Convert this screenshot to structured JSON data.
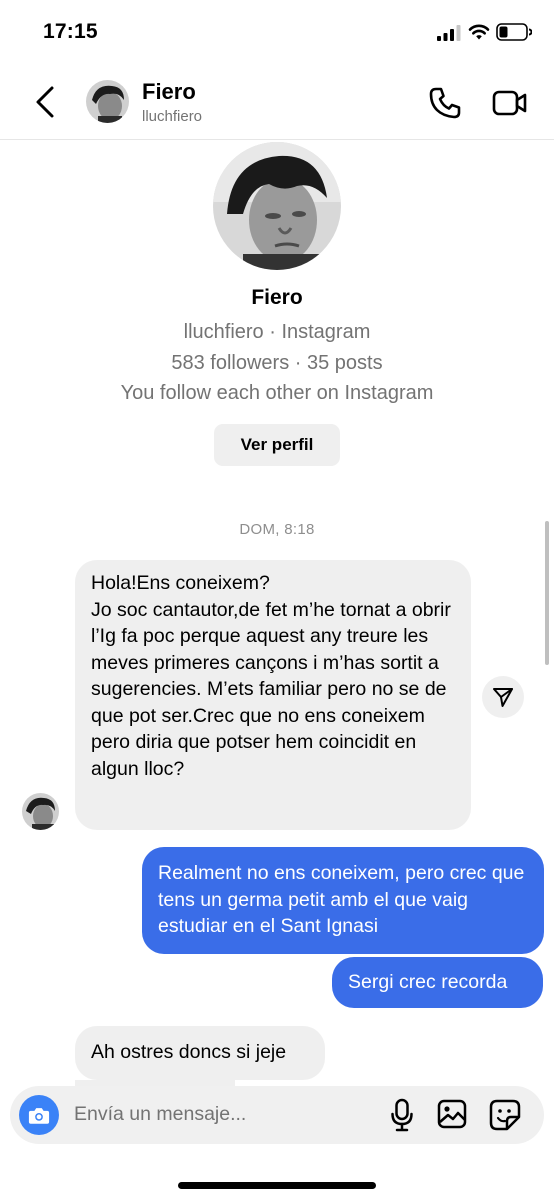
{
  "status_bar": {
    "time": "17:15",
    "battery_level": 0.3
  },
  "header": {
    "name": "Fiero",
    "username": "lluchfiero"
  },
  "profile": {
    "name": "Fiero",
    "line1": "lluchfiero · Instagram",
    "line2": "583 followers · 35 posts",
    "line3": "You follow each other on Instagram",
    "view_profile": "Ver perfil"
  },
  "thread": {
    "timestamp": "DOM, 8:18",
    "messages": [
      {
        "direction": "incoming",
        "paragraphs": [
          "Hola!Ens coneixem?",
          "Jo soc cantautor,de fet m’he tornat a obrir l’Ig fa poc perque aquest any treure les meves primeres cançons i m’has sortit a sugerencies. M’ets familiar pero no se de que pot ser.Crec que no ens coneixem pero diria que potser hem coincidit en algun lloc?"
        ]
      },
      {
        "direction": "outgoing",
        "text": "Realment no ens coneixem, pero crec que tens un germa petit amb el que vaig estudiar en el Sant Ignasi"
      },
      {
        "direction": "outgoing",
        "text": "Sergi crec recorda"
      },
      {
        "direction": "incoming",
        "text": "Ah ostres doncs si jeje"
      }
    ]
  },
  "composer": {
    "placeholder": "Envía un mensaje..."
  },
  "colors": {
    "outgoing_bubble": "#3a6de8",
    "incoming_bubble": "#efefef",
    "camera_button": "#3a82f7"
  },
  "icons": [
    "back-icon",
    "phone-icon",
    "video-camera-icon",
    "send-icon",
    "camera-icon",
    "microphone-icon",
    "gallery-icon",
    "sticker-icon"
  ]
}
